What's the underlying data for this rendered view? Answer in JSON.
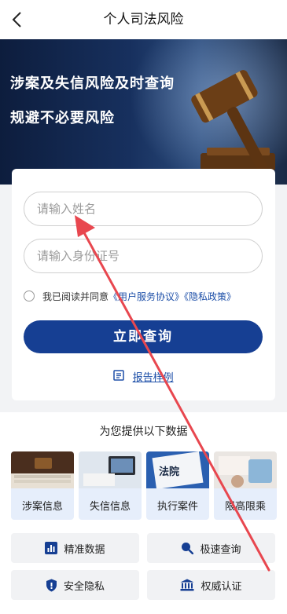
{
  "nav": {
    "title": "个人司法风险",
    "back_icon": "chevron-left-icon"
  },
  "hero": {
    "line1": "涉案及失信风险及时查询",
    "line2": "规避不必要风险"
  },
  "form": {
    "name_placeholder": "请输入姓名",
    "id_placeholder": "请输入身份证号",
    "agree_text": "我已阅读并同意",
    "agree_link": "《用户服务协议》《隐私政策》",
    "submit_label": "立即查询",
    "sample_label": "报告样例"
  },
  "data": {
    "title": "为您提供以下数据",
    "tiles": [
      {
        "label": "涉案信息"
      },
      {
        "label": "失信信息"
      },
      {
        "label": "执行案件"
      },
      {
        "label": "限高限乘"
      }
    ],
    "features": [
      {
        "label": "精准数据",
        "icon": "bar-chart-icon"
      },
      {
        "label": "极速查询",
        "icon": "search-icon"
      },
      {
        "label": "安全隐私",
        "icon": "shield-icon"
      },
      {
        "label": "权威认证",
        "icon": "bank-icon"
      }
    ]
  },
  "colors": {
    "primary": "#163f93",
    "link": "#1d4fa8",
    "annotation": "#e8474f"
  }
}
